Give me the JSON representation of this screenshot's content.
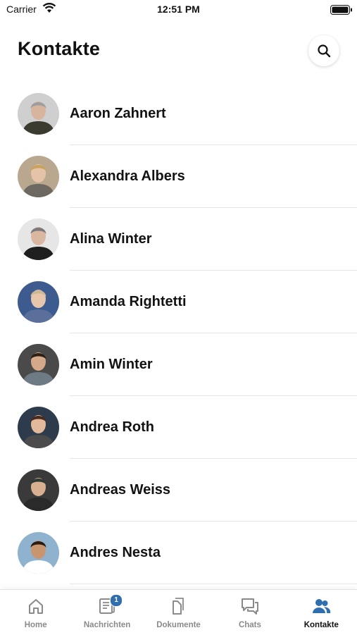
{
  "status_bar": {
    "carrier": "Carrier",
    "time": "12:51 PM"
  },
  "header": {
    "title": "Kontakte",
    "search_icon": "search-icon"
  },
  "contacts": [
    {
      "name": "Aaron Zahnert",
      "avatar_bg": "#cfcfcf",
      "avatar_shirt": "#3b3b2f",
      "avatar_skin": "#d7b49e",
      "avatar_hair": "#9e9e9e"
    },
    {
      "name": "Alexandra Albers",
      "avatar_bg": "#b9a88f",
      "avatar_shirt": "#6d6860",
      "avatar_skin": "#e4c3a8",
      "avatar_hair": "#c9a25c"
    },
    {
      "name": "Alina Winter",
      "avatar_bg": "#e6e6e6",
      "avatar_shirt": "#1f1f1f",
      "avatar_skin": "#d9b7a1",
      "avatar_hair": "#7a7a7a"
    },
    {
      "name": "Amanda Rightetti",
      "avatar_bg": "#3e5b8f",
      "avatar_shirt": "#5a6f9a",
      "avatar_skin": "#e8c6ad",
      "avatar_hair": "#cbb894"
    },
    {
      "name": "Amin Winter",
      "avatar_bg": "#4a4a4a",
      "avatar_shirt": "#6e7a84",
      "avatar_skin": "#d4a98a",
      "avatar_hair": "#2b1f17"
    },
    {
      "name": "Andrea Roth",
      "avatar_bg": "#2e3b4d",
      "avatar_shirt": "#4b4b4b",
      "avatar_skin": "#e2b99b",
      "avatar_hair": "#4a2a1a"
    },
    {
      "name": "Andreas Weiss",
      "avatar_bg": "#3a3a3a",
      "avatar_shirt": "#2a2a2a",
      "avatar_skin": "#d9b08f",
      "avatar_hair": "#2f3a36"
    },
    {
      "name": "Andres Nesta",
      "avatar_bg": "#8fb3cf",
      "avatar_shirt": "#ffffff",
      "avatar_skin": "#c8956f",
      "avatar_hair": "#2a1b12"
    }
  ],
  "tab_bar": {
    "tabs": [
      {
        "label": "Home",
        "icon": "home-icon"
      },
      {
        "label": "Nachrichten",
        "icon": "newspaper-icon",
        "badge": "1"
      },
      {
        "label": "Dokumente",
        "icon": "document-icon"
      },
      {
        "label": "Chats",
        "icon": "chat-icon"
      },
      {
        "label": "Kontakte",
        "icon": "contacts-icon",
        "active": true
      }
    ],
    "active_color": "#2f6fb0",
    "inactive_color": "#8a8a8a"
  }
}
